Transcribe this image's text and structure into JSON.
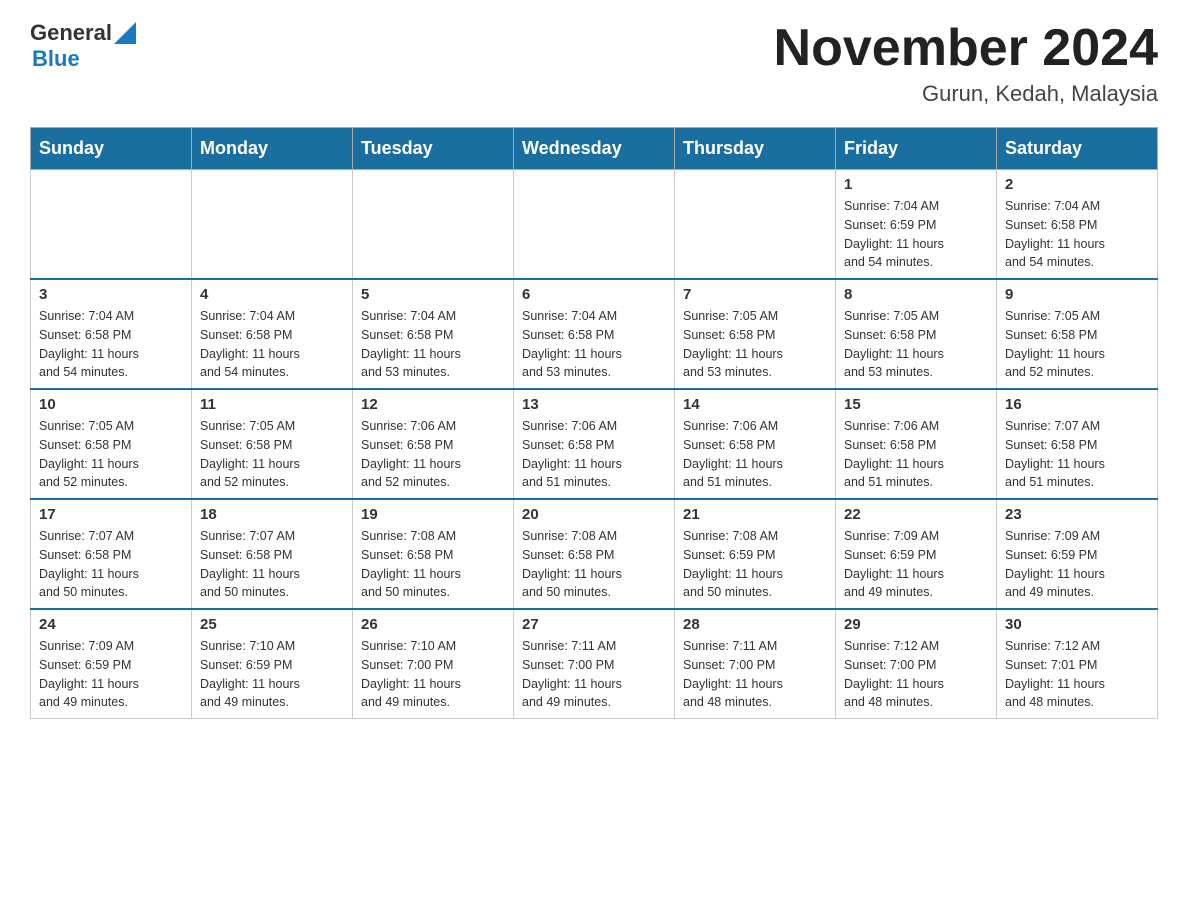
{
  "header": {
    "logo": {
      "general": "General",
      "blue": "Blue"
    },
    "title": "November 2024",
    "location": "Gurun, Kedah, Malaysia"
  },
  "weekdays": [
    "Sunday",
    "Monday",
    "Tuesday",
    "Wednesday",
    "Thursday",
    "Friday",
    "Saturday"
  ],
  "weeks": [
    [
      {
        "day": "",
        "info": ""
      },
      {
        "day": "",
        "info": ""
      },
      {
        "day": "",
        "info": ""
      },
      {
        "day": "",
        "info": ""
      },
      {
        "day": "",
        "info": ""
      },
      {
        "day": "1",
        "info": "Sunrise: 7:04 AM\nSunset: 6:59 PM\nDaylight: 11 hours\nand 54 minutes."
      },
      {
        "day": "2",
        "info": "Sunrise: 7:04 AM\nSunset: 6:58 PM\nDaylight: 11 hours\nand 54 minutes."
      }
    ],
    [
      {
        "day": "3",
        "info": "Sunrise: 7:04 AM\nSunset: 6:58 PM\nDaylight: 11 hours\nand 54 minutes."
      },
      {
        "day": "4",
        "info": "Sunrise: 7:04 AM\nSunset: 6:58 PM\nDaylight: 11 hours\nand 54 minutes."
      },
      {
        "day": "5",
        "info": "Sunrise: 7:04 AM\nSunset: 6:58 PM\nDaylight: 11 hours\nand 53 minutes."
      },
      {
        "day": "6",
        "info": "Sunrise: 7:04 AM\nSunset: 6:58 PM\nDaylight: 11 hours\nand 53 minutes."
      },
      {
        "day": "7",
        "info": "Sunrise: 7:05 AM\nSunset: 6:58 PM\nDaylight: 11 hours\nand 53 minutes."
      },
      {
        "day": "8",
        "info": "Sunrise: 7:05 AM\nSunset: 6:58 PM\nDaylight: 11 hours\nand 53 minutes."
      },
      {
        "day": "9",
        "info": "Sunrise: 7:05 AM\nSunset: 6:58 PM\nDaylight: 11 hours\nand 52 minutes."
      }
    ],
    [
      {
        "day": "10",
        "info": "Sunrise: 7:05 AM\nSunset: 6:58 PM\nDaylight: 11 hours\nand 52 minutes."
      },
      {
        "day": "11",
        "info": "Sunrise: 7:05 AM\nSunset: 6:58 PM\nDaylight: 11 hours\nand 52 minutes."
      },
      {
        "day": "12",
        "info": "Sunrise: 7:06 AM\nSunset: 6:58 PM\nDaylight: 11 hours\nand 52 minutes."
      },
      {
        "day": "13",
        "info": "Sunrise: 7:06 AM\nSunset: 6:58 PM\nDaylight: 11 hours\nand 51 minutes."
      },
      {
        "day": "14",
        "info": "Sunrise: 7:06 AM\nSunset: 6:58 PM\nDaylight: 11 hours\nand 51 minutes."
      },
      {
        "day": "15",
        "info": "Sunrise: 7:06 AM\nSunset: 6:58 PM\nDaylight: 11 hours\nand 51 minutes."
      },
      {
        "day": "16",
        "info": "Sunrise: 7:07 AM\nSunset: 6:58 PM\nDaylight: 11 hours\nand 51 minutes."
      }
    ],
    [
      {
        "day": "17",
        "info": "Sunrise: 7:07 AM\nSunset: 6:58 PM\nDaylight: 11 hours\nand 50 minutes."
      },
      {
        "day": "18",
        "info": "Sunrise: 7:07 AM\nSunset: 6:58 PM\nDaylight: 11 hours\nand 50 minutes."
      },
      {
        "day": "19",
        "info": "Sunrise: 7:08 AM\nSunset: 6:58 PM\nDaylight: 11 hours\nand 50 minutes."
      },
      {
        "day": "20",
        "info": "Sunrise: 7:08 AM\nSunset: 6:58 PM\nDaylight: 11 hours\nand 50 minutes."
      },
      {
        "day": "21",
        "info": "Sunrise: 7:08 AM\nSunset: 6:59 PM\nDaylight: 11 hours\nand 50 minutes."
      },
      {
        "day": "22",
        "info": "Sunrise: 7:09 AM\nSunset: 6:59 PM\nDaylight: 11 hours\nand 49 minutes."
      },
      {
        "day": "23",
        "info": "Sunrise: 7:09 AM\nSunset: 6:59 PM\nDaylight: 11 hours\nand 49 minutes."
      }
    ],
    [
      {
        "day": "24",
        "info": "Sunrise: 7:09 AM\nSunset: 6:59 PM\nDaylight: 11 hours\nand 49 minutes."
      },
      {
        "day": "25",
        "info": "Sunrise: 7:10 AM\nSunset: 6:59 PM\nDaylight: 11 hours\nand 49 minutes."
      },
      {
        "day": "26",
        "info": "Sunrise: 7:10 AM\nSunset: 7:00 PM\nDaylight: 11 hours\nand 49 minutes."
      },
      {
        "day": "27",
        "info": "Sunrise: 7:11 AM\nSunset: 7:00 PM\nDaylight: 11 hours\nand 49 minutes."
      },
      {
        "day": "28",
        "info": "Sunrise: 7:11 AM\nSunset: 7:00 PM\nDaylight: 11 hours\nand 48 minutes."
      },
      {
        "day": "29",
        "info": "Sunrise: 7:12 AM\nSunset: 7:00 PM\nDaylight: 11 hours\nand 48 minutes."
      },
      {
        "day": "30",
        "info": "Sunrise: 7:12 AM\nSunset: 7:01 PM\nDaylight: 11 hours\nand 48 minutes."
      }
    ]
  ]
}
